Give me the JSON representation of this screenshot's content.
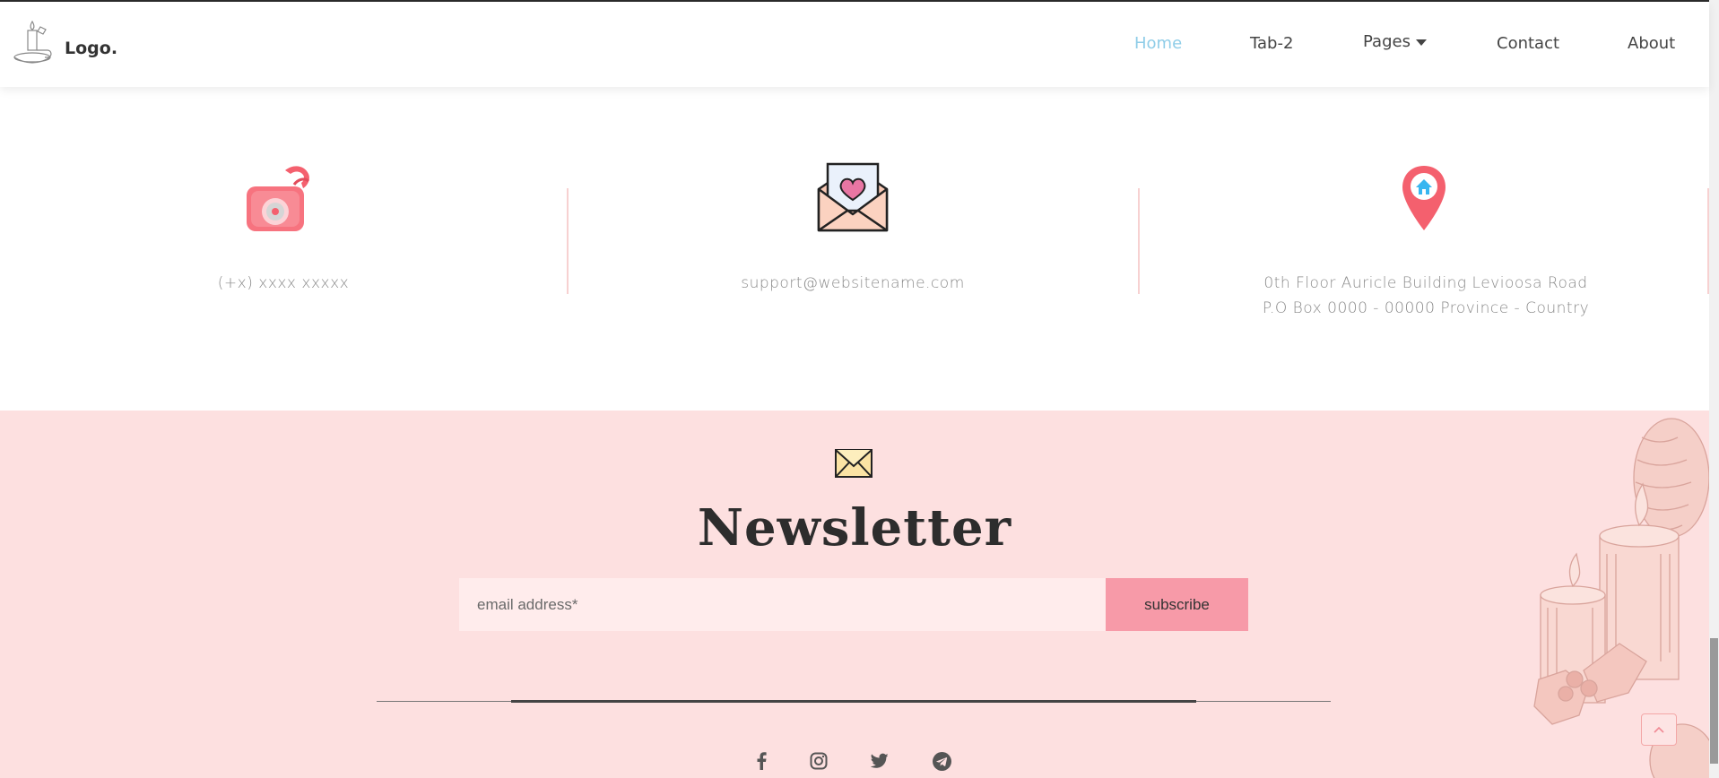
{
  "header": {
    "logo_text": "Logo.",
    "nav": [
      {
        "label": "Home",
        "active": true
      },
      {
        "label": "Tab-2"
      },
      {
        "label": "Pages"
      },
      {
        "label": "Contact"
      },
      {
        "label": "About"
      }
    ]
  },
  "contact": {
    "phone": "(+x) xxxx xxxxx",
    "email": "support@websitename.com",
    "address_line1": "0th Floor Auricle Building Levioosa Road",
    "address_line2": "P.O Box 0000 - 00000 Province - Country"
  },
  "newsletter": {
    "title": "Newsletter",
    "email_placeholder": "email address*",
    "subscribe_label": "subscribe"
  },
  "social": [
    "facebook-icon",
    "instagram-icon",
    "twitter-icon",
    "telegram-icon"
  ],
  "colors": {
    "accent_active": "#8fcde8",
    "newsletter_bg": "#fde0e0",
    "button_pink": "#f79aa8",
    "divider_pink": "#f7d1d1"
  }
}
